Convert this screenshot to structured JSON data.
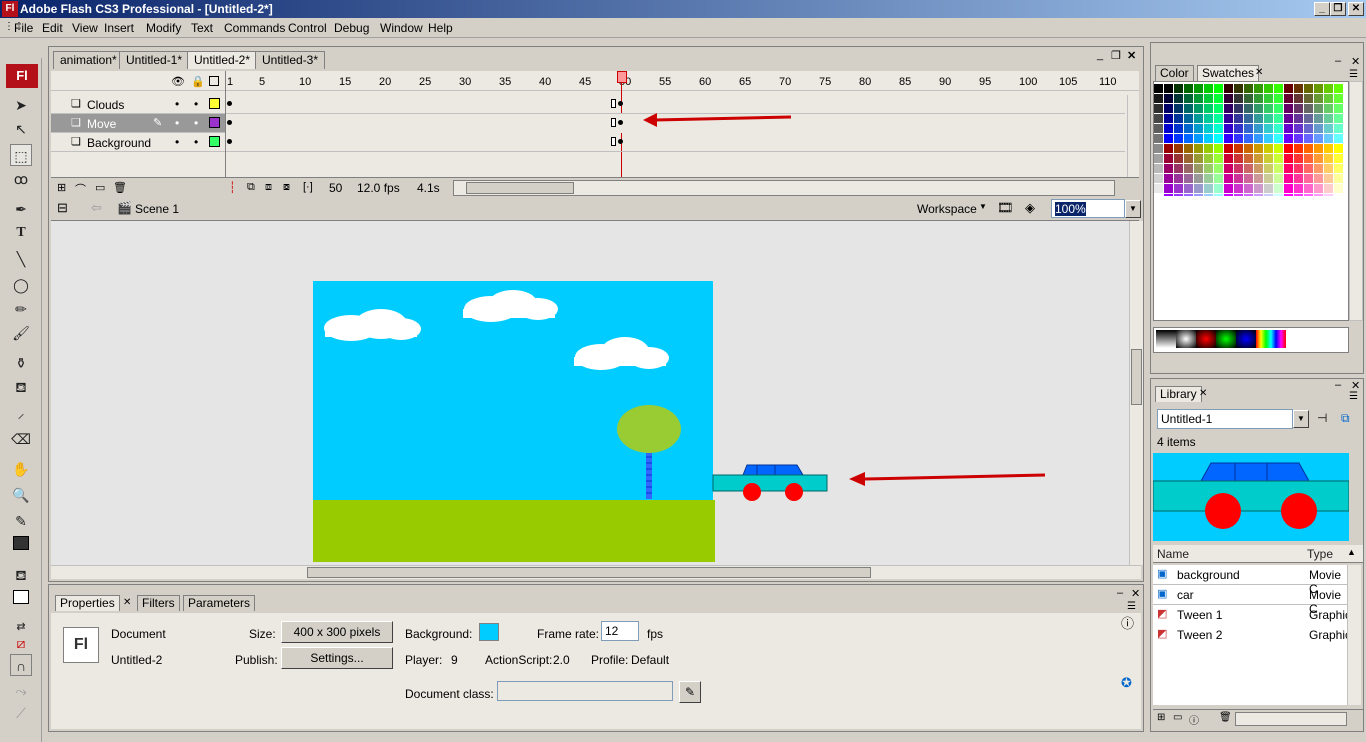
{
  "titlebar": {
    "logo": "Fl",
    "title": "Adobe Flash CS3 Professional - [Untitled-2*]",
    "min": "_",
    "restore": "❐",
    "close": "✕"
  },
  "menu": {
    "items": [
      "File",
      "Edit",
      "View",
      "Insert",
      "Modify",
      "Text",
      "Commands",
      "Control",
      "Debug",
      "Window",
      "Help"
    ]
  },
  "tools": {
    "badge": "Fl"
  },
  "doc_tabs": [
    "animation*",
    "Untitled-1*",
    "Untitled-2*",
    "Untitled-3*"
  ],
  "timeline": {
    "frame_numbers": [
      "1",
      "5",
      "10",
      "15",
      "20",
      "25",
      "30",
      "35",
      "40",
      "45",
      "50",
      "55",
      "60",
      "65",
      "70",
      "75",
      "80",
      "85",
      "90",
      "95",
      "100",
      "105",
      "110"
    ],
    "layers": [
      {
        "name": "Clouds",
        "color": "#ffff33"
      },
      {
        "name": "Move",
        "color": "#9933cc"
      },
      {
        "name": "Background",
        "color": "#33ff66"
      }
    ],
    "current_frame": "50",
    "fps": "12.0 fps",
    "time": "4.1s"
  },
  "editbar": {
    "scene": "Scene 1",
    "workspace": "Workspace",
    "zoom": "100%"
  },
  "stage": {
    "sky": "#00ccff",
    "grass": "#99cc00",
    "tree_top": "#99cc33",
    "trunk": "#3366ff",
    "car_body": "#00cccc",
    "car_roof": "#0066ff",
    "wheels": "#ff0000"
  },
  "right_panels": {
    "color_tabs": [
      "Color",
      "Swatches"
    ],
    "library": {
      "tab": "Library",
      "document": "Untitled-1",
      "count": "4 items",
      "col_name": "Name",
      "col_type": "Type",
      "items": [
        {
          "name": "background",
          "type": "Movie C"
        },
        {
          "name": "car",
          "type": "Movie C"
        },
        {
          "name": "Tween 1",
          "type": "Graphic"
        },
        {
          "name": "Tween 2",
          "type": "Graphic"
        }
      ]
    }
  },
  "properties": {
    "tabs": [
      "Properties",
      "Filters",
      "Parameters"
    ],
    "doc_label": "Document",
    "doc_name": "Untitled-2",
    "logo": "Fl",
    "size_label": "Size:",
    "size_value": "400 x 300 pixels",
    "publish_label": "Publish:",
    "settings_btn": "Settings...",
    "background_label": "Background:",
    "background_color": "#00ccff",
    "framerate_label": "Frame rate:",
    "framerate_value": "12",
    "fps_unit": "fps",
    "player_label": "Player:",
    "player_value": "9",
    "as_label": "ActionScript:",
    "as_value": "2.0",
    "profile_label": "Profile:",
    "profile_value": "Default",
    "docclass_label": "Document class:",
    "docclass_value": ""
  },
  "annotation_color": "#cc0000"
}
